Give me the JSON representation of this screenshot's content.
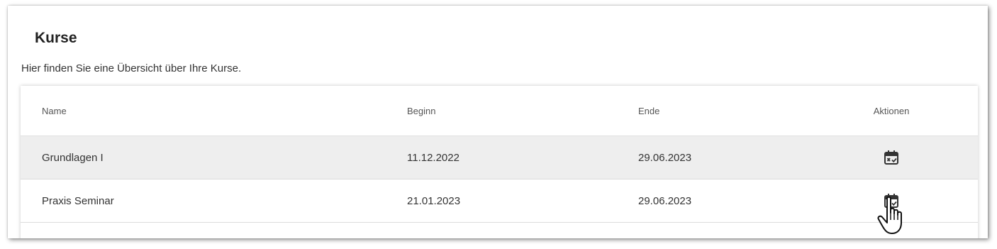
{
  "page": {
    "title": "Kurse",
    "subtitle": "Hier finden Sie eine Übersicht über Ihre Kurse."
  },
  "table": {
    "columns": {
      "name": "Name",
      "beginn": "Beginn",
      "ende": "Ende",
      "aktionen": "Aktionen"
    },
    "rows": [
      {
        "name": "Grundlagen I",
        "beginn": "11.12.2022",
        "ende": "29.06.2023",
        "action_icon": "calendar-check-icon"
      },
      {
        "name": "Praxis Seminar",
        "beginn": "21.01.2023",
        "ende": "29.06.2023",
        "action_icon": "calendar-check-icon"
      }
    ]
  },
  "colors": {
    "highlight_row": "#eeeeee",
    "icon": "#333333"
  },
  "pointer": "hand-pointer-icon"
}
